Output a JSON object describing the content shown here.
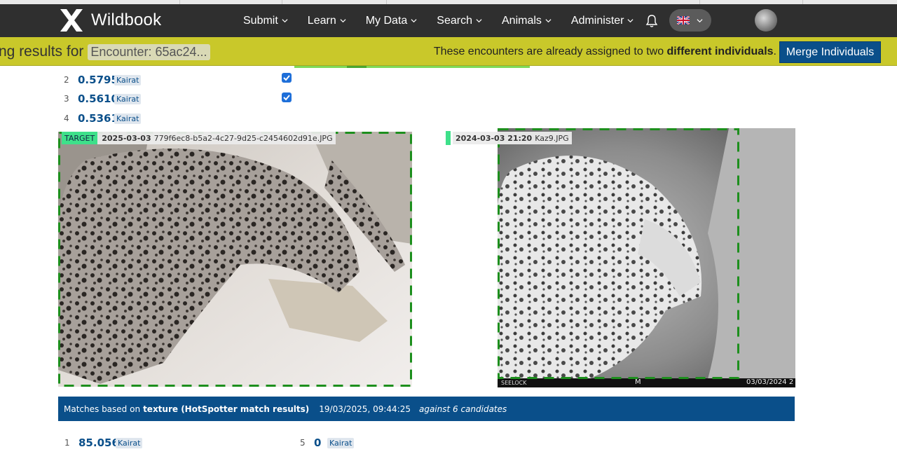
{
  "navbar": {
    "brand": "Wildbook",
    "menu": [
      {
        "label": "Submit"
      },
      {
        "label": "Learn"
      },
      {
        "label": "My Data"
      },
      {
        "label": "Search"
      },
      {
        "label": "Animals"
      },
      {
        "label": "Administer"
      }
    ],
    "icons": [
      "wildbook-logo-icon",
      "chevron-down-icon",
      "bell-icon",
      "uk-flag-icon",
      "avatar"
    ]
  },
  "header": {
    "title": "ng results for",
    "encounter_chip": "Encounter: 65ac24...",
    "assign_msg_prefix": "These encounters are already assigned to two ",
    "assign_msg_bold": "different individuals",
    "assign_msg_suffix": ".",
    "merge_button": "Merge Individuals"
  },
  "scores_top": [
    {
      "rank": "2",
      "score": "0.5795",
      "individual": "Kairat",
      "checked": true
    },
    {
      "rank": "3",
      "score": "0.5610",
      "individual": "Kairat",
      "checked": true
    },
    {
      "rank": "4",
      "score": "0.5361",
      "individual": "Kairat",
      "checked": false
    }
  ],
  "target_image": {
    "badge": "TARGET",
    "date": "2025-03-03",
    "filename": "779f6ec8-b5a2-4c27-9d25-c2454602d91e.JPG"
  },
  "candidate_image": {
    "datetime": "2024-03-03 21:20",
    "filename": "Kaz9.JPG",
    "camera_brand": "SEELOCK",
    "camera_mode": "M",
    "camera_date": "03/03/2024 2"
  },
  "match_bar": {
    "prefix": "Matches based on",
    "method": "texture (HotSpotter match results)",
    "timestamp": "19/03/2025, 09:44:25",
    "candidates": "against 6 candidates"
  },
  "scores_bottom": [
    {
      "rank": "1",
      "score": "85.056",
      "individual": "Kairat"
    },
    {
      "rank": "5",
      "score": "0",
      "individual": "Kairat"
    }
  ],
  "colors": {
    "navbar": "#2f2f2f",
    "yellow_bar": "#c9c82a",
    "primary_blue": "#0a4f8a",
    "target_green": "#3ee08a",
    "dash_green": "#1d8f1d"
  }
}
